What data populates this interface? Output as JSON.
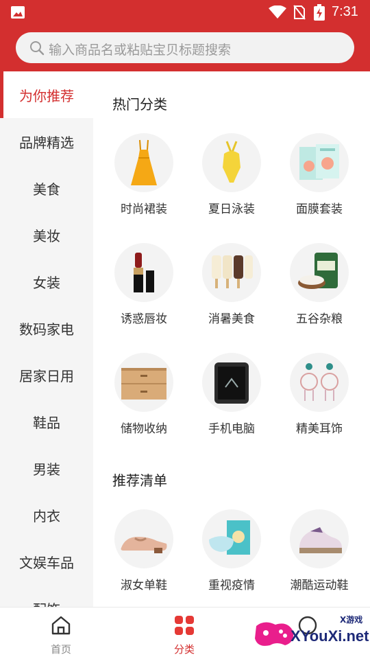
{
  "status_bar": {
    "time": "7:31"
  },
  "search": {
    "placeholder": "输入商品名或粘贴宝贝标题搜索"
  },
  "sidebar": {
    "items": [
      {
        "label": "为你推荐",
        "active": true
      },
      {
        "label": "品牌精选"
      },
      {
        "label": "美食"
      },
      {
        "label": "美妆"
      },
      {
        "label": "女装"
      },
      {
        "label": "数码家电"
      },
      {
        "label": "居家日用"
      },
      {
        "label": "鞋品"
      },
      {
        "label": "男装"
      },
      {
        "label": "内衣"
      },
      {
        "label": "文娱车品"
      },
      {
        "label": "配饰"
      }
    ]
  },
  "sections": [
    {
      "title": "热门分类",
      "items": [
        {
          "label": "时尚裙装",
          "icon": "dress-icon"
        },
        {
          "label": "夏日泳装",
          "icon": "swimsuit-icon"
        },
        {
          "label": "面膜套装",
          "icon": "face-mask-box-icon"
        },
        {
          "label": "诱惑唇妆",
          "icon": "lipstick-icon"
        },
        {
          "label": "消暑美食",
          "icon": "ice-cream-icon"
        },
        {
          "label": "五谷杂粮",
          "icon": "rice-bag-icon"
        },
        {
          "label": "储物收纳",
          "icon": "storage-drawer-icon"
        },
        {
          "label": "手机电脑",
          "icon": "rugged-phone-icon"
        },
        {
          "label": "精美耳饰",
          "icon": "earrings-icon"
        }
      ]
    },
    {
      "title": "推荐清单",
      "items": [
        {
          "label": "淑女单鞋",
          "icon": "loafer-shoe-icon"
        },
        {
          "label": "重视疫情",
          "icon": "medical-mask-box-icon"
        },
        {
          "label": "潮酷运动鞋",
          "icon": "sneaker-icon"
        }
      ]
    }
  ],
  "bottom_nav": {
    "tabs": [
      {
        "label": "首页",
        "icon": "home-icon"
      },
      {
        "label": "分类",
        "icon": "grid-icon",
        "active": true
      }
    ]
  },
  "watermark": {
    "text": "XYouXi.net",
    "small": "X游戏"
  },
  "colors": {
    "brand_red": "#d32f2f",
    "sidebar_bg": "#f5f5f5",
    "thumb_bg": "#f3f3f3"
  }
}
